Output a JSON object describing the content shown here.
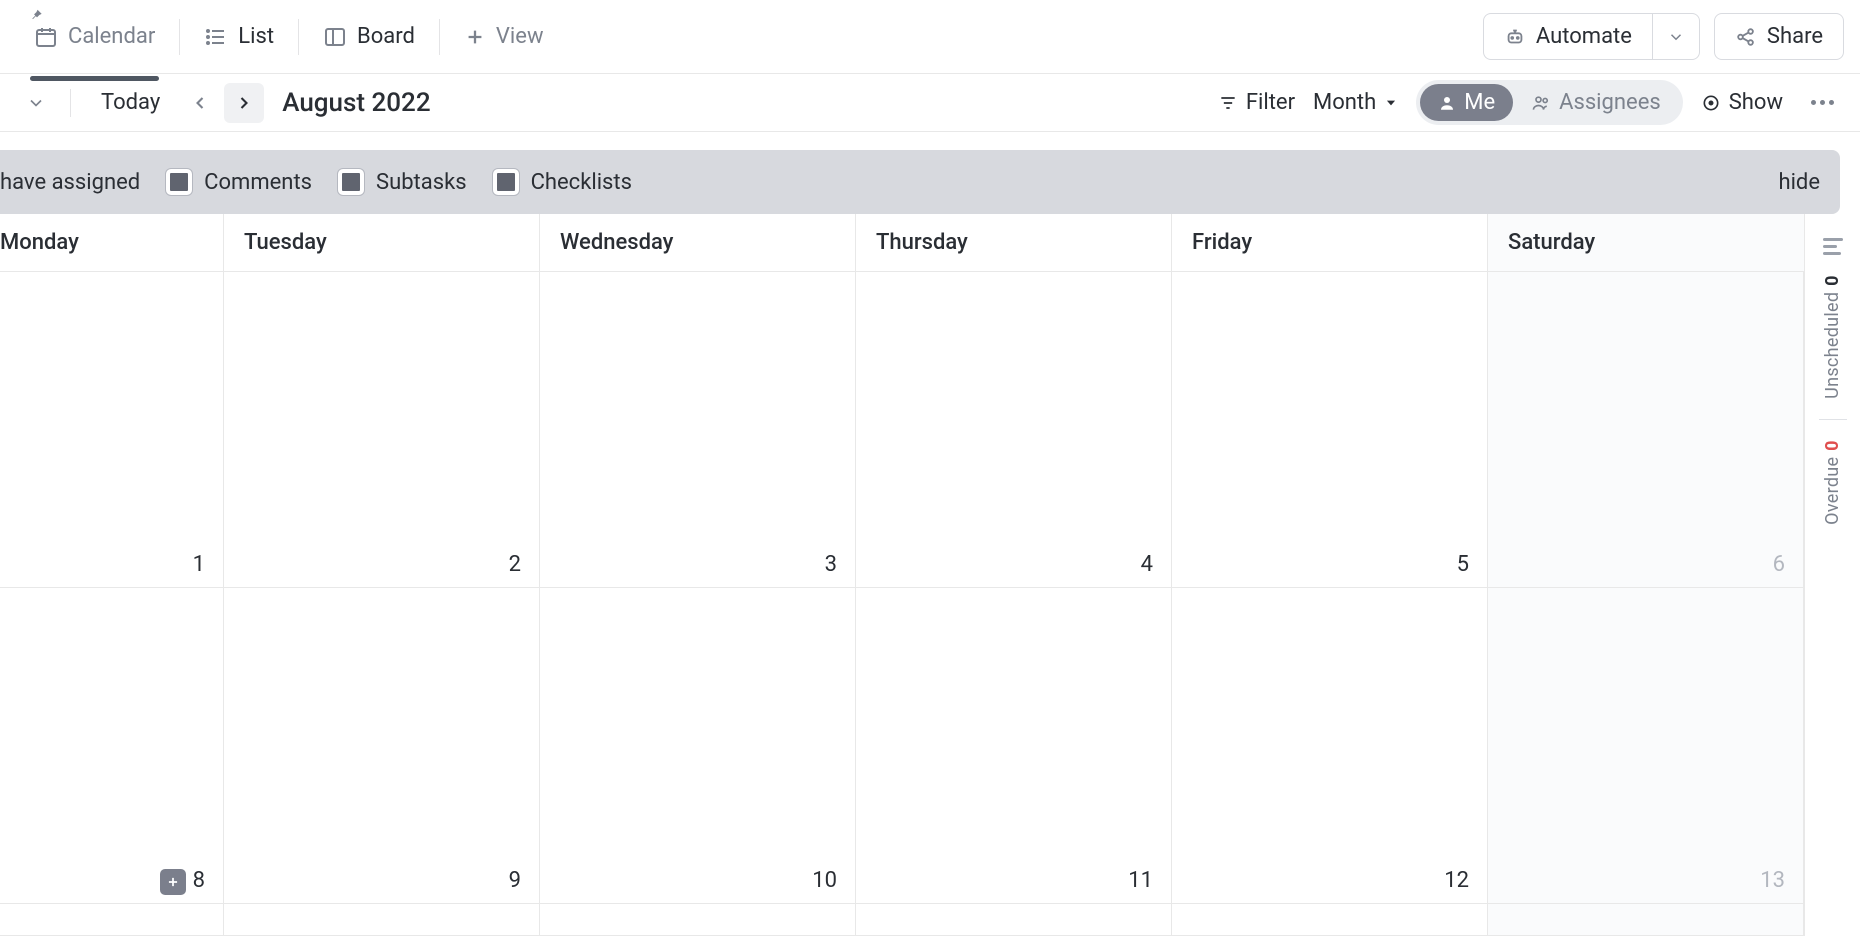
{
  "views": {
    "calendar": "Calendar",
    "list": "List",
    "board": "Board",
    "add_view": "View"
  },
  "header": {
    "automate": "Automate",
    "share": "Share"
  },
  "nav": {
    "today": "Today",
    "period_title": "August 2022",
    "filter": "Filter",
    "timescale": "Month",
    "me": "Me",
    "assignees": "Assignees",
    "show": "Show"
  },
  "filter_bar": {
    "partial_label": "have assigned",
    "comments": "Comments",
    "subtasks": "Subtasks",
    "checklists": "Checklists",
    "hide": "hide"
  },
  "calendar": {
    "day_headers": [
      "Monday",
      "Tuesday",
      "Wednesday",
      "Thursday",
      "Friday",
      "Saturday"
    ],
    "weeks": [
      {
        "dates": [
          "1",
          "2",
          "3",
          "4",
          "5",
          "6"
        ],
        "muted": [
          false,
          false,
          false,
          false,
          false,
          true
        ]
      },
      {
        "dates": [
          "8",
          "9",
          "10",
          "11",
          "12",
          "13"
        ],
        "muted": [
          false,
          false,
          false,
          false,
          false,
          true
        ]
      }
    ]
  },
  "rail": {
    "unscheduled_label": "Unscheduled",
    "unscheduled_count": "0",
    "overdue_label": "Overdue",
    "overdue_count": "0"
  }
}
